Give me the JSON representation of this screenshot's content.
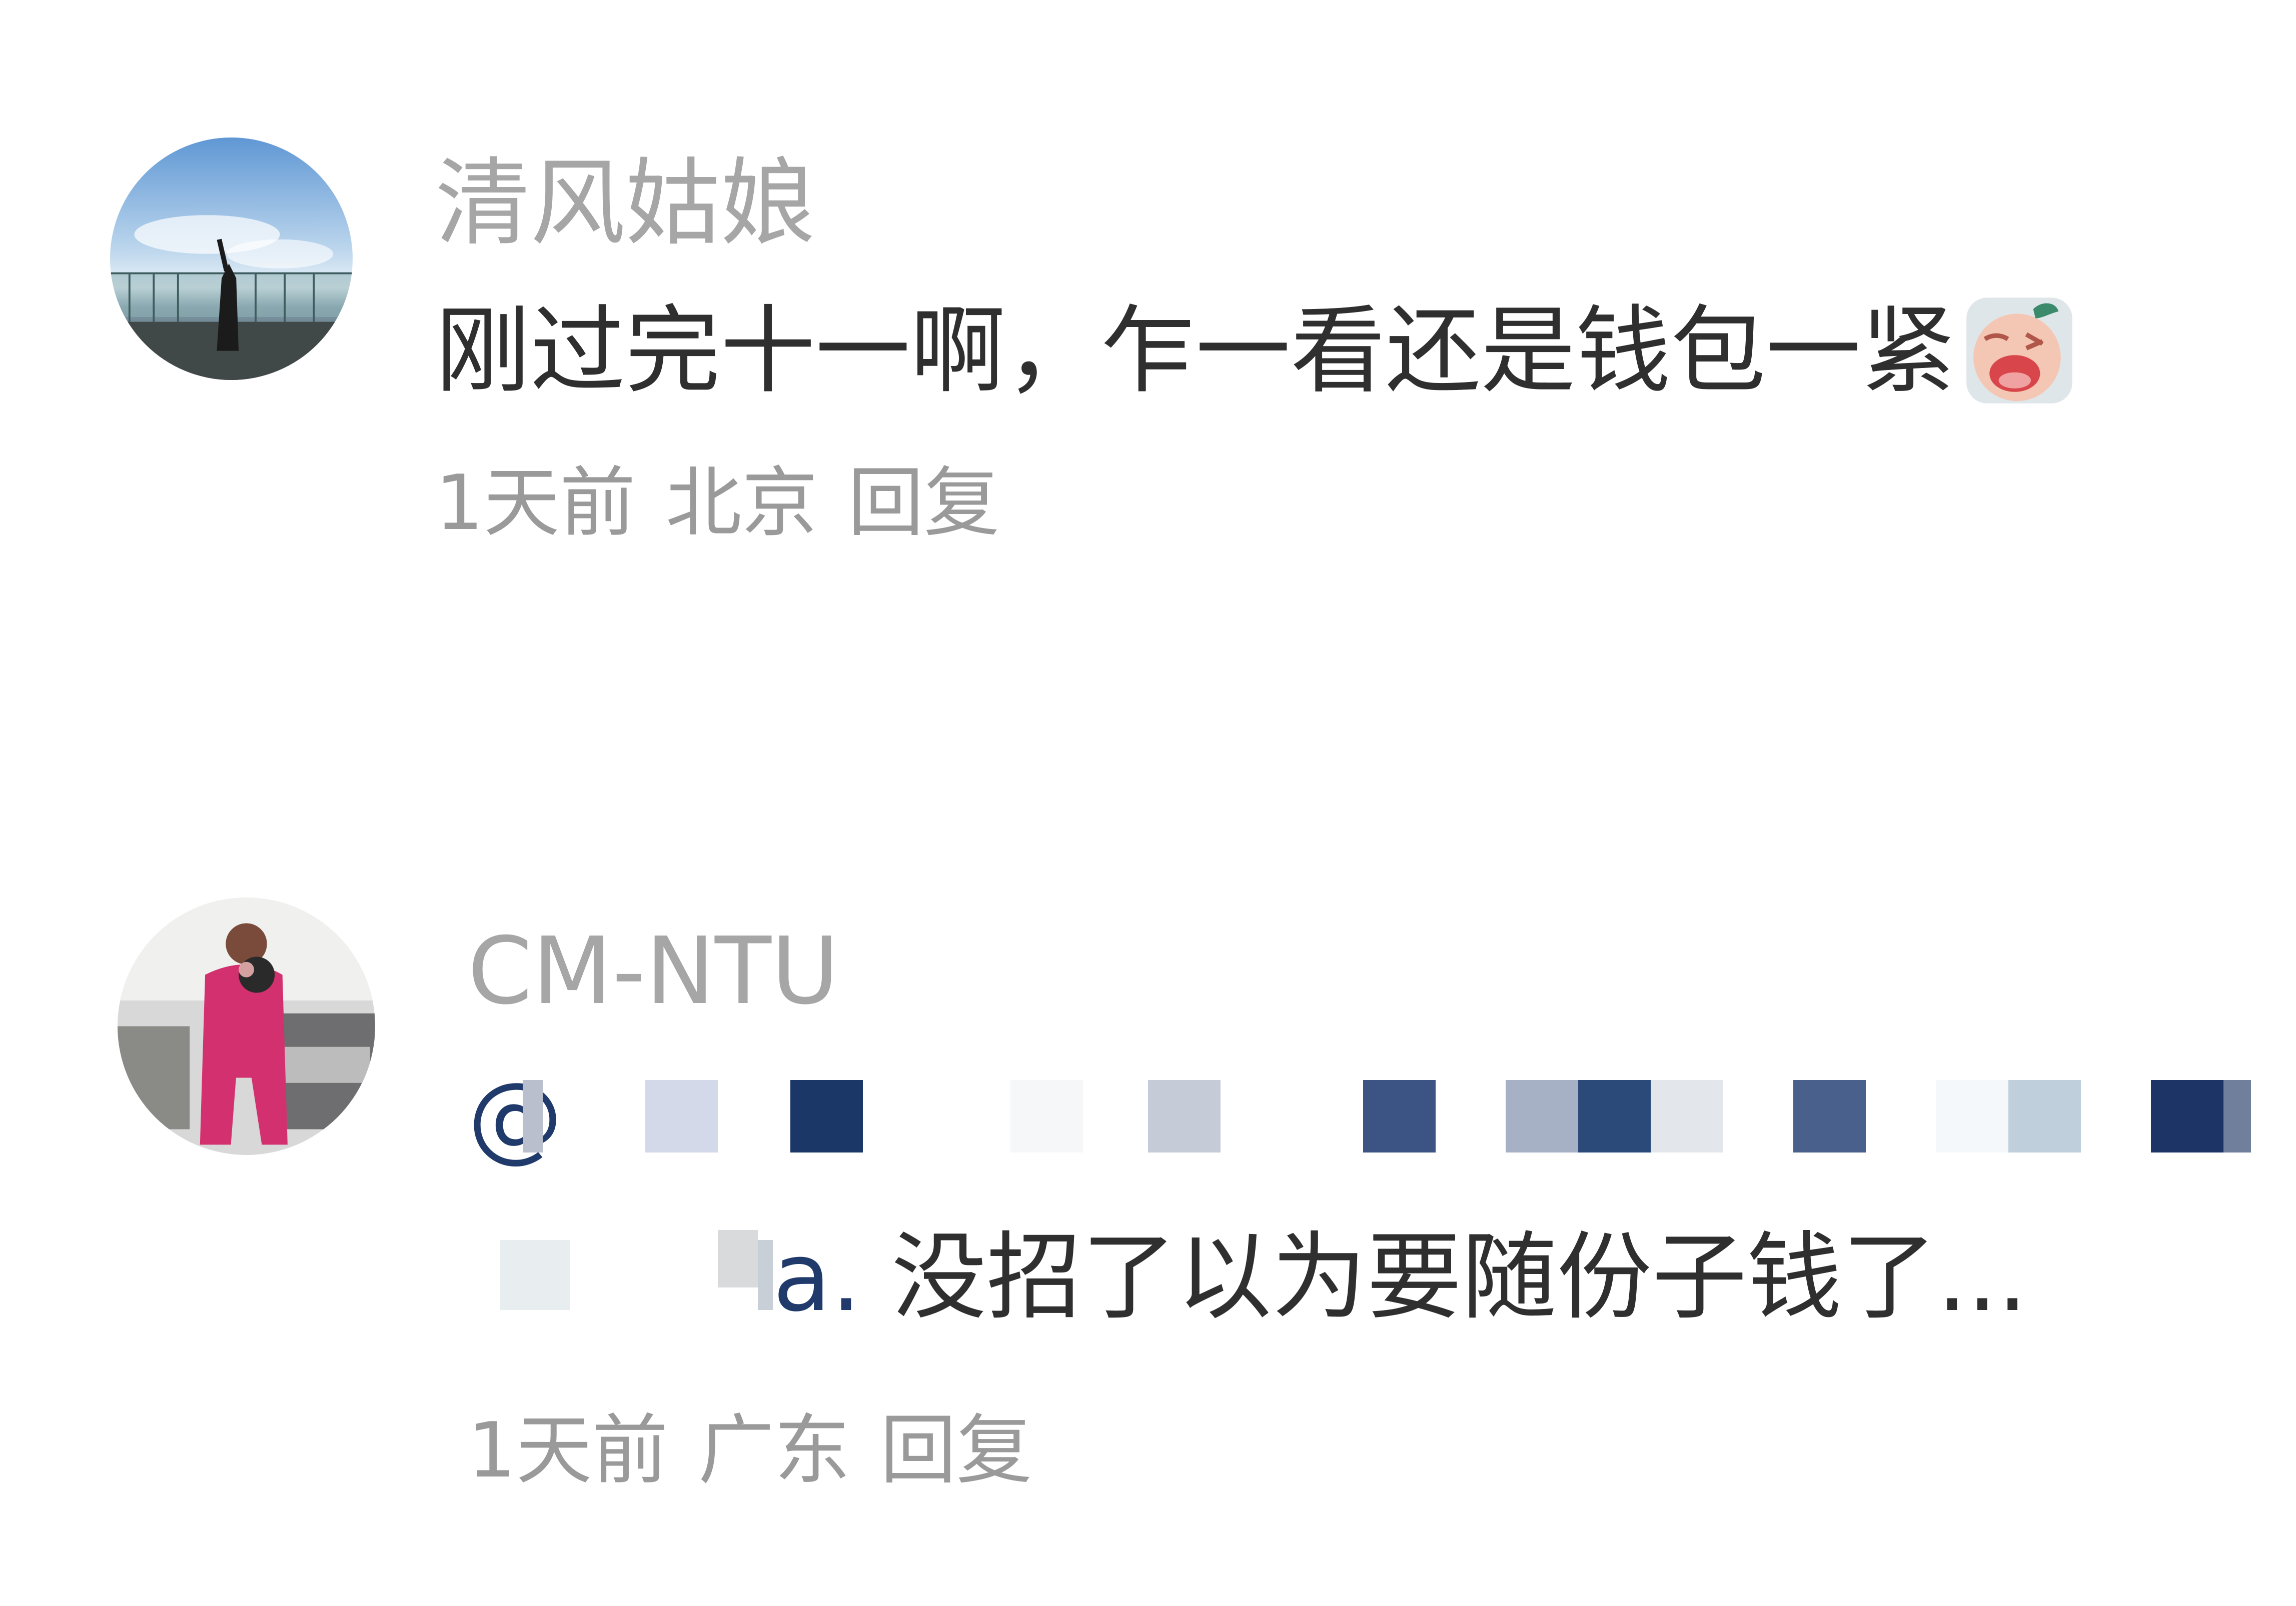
{
  "comments": [
    {
      "username": "清风姑娘",
      "text": "刚过完十一啊，乍一看还是钱包一紧",
      "emoji": "crying-face-emoji",
      "time": "1天前",
      "location": "北京",
      "reply": "回复"
    },
    {
      "username": "CM-NTU",
      "mention_prefix": "@",
      "mention_tail": "a.",
      "text": "没招了以为要随份子钱了...",
      "time": "1天前",
      "location": "广东",
      "reply": "回复"
    }
  ],
  "colors": {
    "username": "#a6a6a6",
    "body": "#2f2f2f",
    "meta": "#9a9a9a",
    "mention": "#1f3a6b"
  }
}
